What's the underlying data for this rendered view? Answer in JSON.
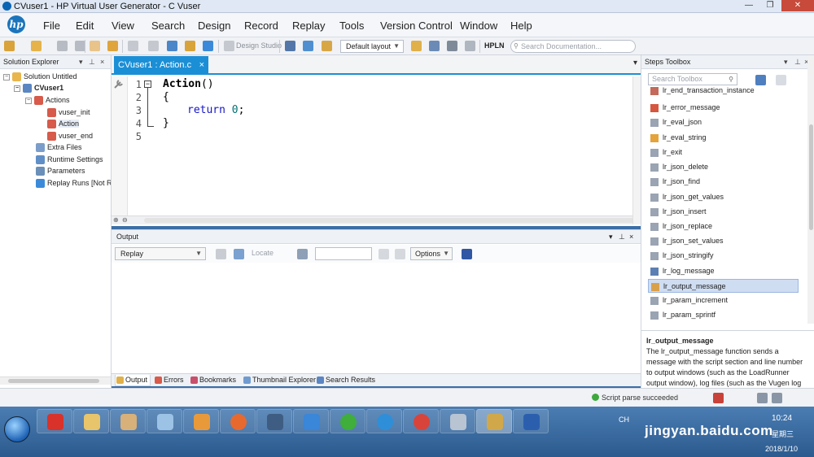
{
  "window": {
    "title": "CVuser1 - HP Virtual User Generator - C Vuser",
    "controls": [
      "—",
      "❐",
      "✕"
    ]
  },
  "menu": {
    "logo": "hp",
    "items": [
      "File",
      "Edit",
      "View",
      "Search",
      "Design",
      "Record",
      "Replay",
      "Tools",
      "Version Control",
      "Window",
      "Help"
    ]
  },
  "toolbar": {
    "design_studio": "Design Studio",
    "layout": "Default layout",
    "hpln": "HPLN",
    "doc_search_placeholder": "Search Documentation..."
  },
  "solution_explorer": {
    "title": "Solution Explorer",
    "items": [
      {
        "label": "Solution Untitled",
        "icon": "solution-icon"
      },
      {
        "label": "CVuser1",
        "icon": "script-icon"
      },
      {
        "label": "Actions",
        "icon": "actions-folder-icon"
      },
      {
        "label": "vuser_init",
        "icon": "action-icon"
      },
      {
        "label": "Action",
        "icon": "action-icon"
      },
      {
        "label": "vuser_end",
        "icon": "action-icon"
      },
      {
        "label": "Extra Files",
        "icon": "files-icon"
      },
      {
        "label": "Runtime Settings",
        "icon": "settings-icon"
      },
      {
        "label": "Parameters",
        "icon": "parameters-icon"
      },
      {
        "label": "Replay Runs [Not Run]",
        "icon": "replay-icon"
      }
    ]
  },
  "editor": {
    "tab_label": "CVuser1 : Action.c",
    "line_numbers": [
      "1",
      "2",
      "3",
      "4",
      "5"
    ],
    "code": {
      "func": "Action",
      "parens": "()",
      "open": "{",
      "ret_kw": "return",
      "ret_val": "0",
      "semi": ";",
      "close": "}"
    }
  },
  "output": {
    "title": "Output",
    "source": "Replay",
    "locate": "Locate",
    "options": "Options"
  },
  "bottom_tabs": [
    "Output",
    "Errors",
    "Bookmarks",
    "Thumbnail Explorer",
    "Search Results"
  ],
  "steps_toolbox": {
    "title": "Steps Toolbox",
    "search_placeholder": "Search Toolbox",
    "steps": [
      "lr_end_transaction_instance",
      "lr_error_message",
      "lr_eval_json",
      "lr_eval_string",
      "lr_exit",
      "lr_json_delete",
      "lr_json_find",
      "lr_json_get_values",
      "lr_json_insert",
      "lr_json_replace",
      "lr_json_set_values",
      "lr_json_stringify",
      "lr_log_message",
      "lr_output_message",
      "lr_param_increment",
      "lr_param_sprintf"
    ],
    "selected_step": "lr_output_message",
    "desc_title": "lr_output_message",
    "desc_text": "The lr_output_message function sends a message with the script section and line number to output windows (such as the LoadRunner output window), log files (such as the Vugen log file and the Application"
  },
  "status": {
    "message": "Script parse succeeded"
  },
  "taskbar": {
    "apps": [
      "app-red",
      "explorer",
      "paint",
      "notes",
      "search-app",
      "firefox",
      "media",
      "pen",
      "refresh",
      "ie",
      "chrome",
      "calculator",
      "vugen",
      "word"
    ],
    "lang": "CH",
    "time": "10:24",
    "day": "星期三",
    "date": "2018/1/10"
  },
  "watermark": "jingyan.baidu.com"
}
